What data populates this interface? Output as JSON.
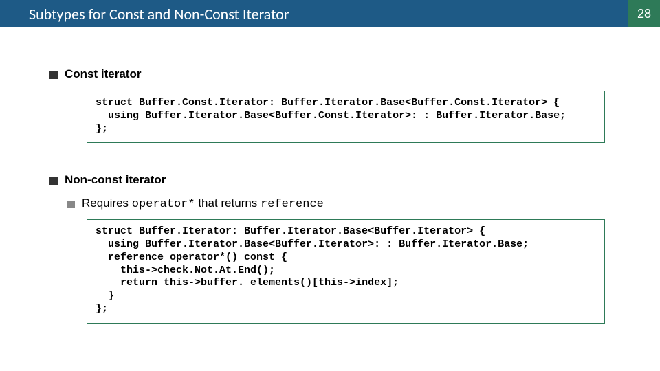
{
  "slide": {
    "number": "28",
    "title": "Subtypes for Const and Non-Const Iterator"
  },
  "sections": [
    {
      "heading": "Const iterator",
      "sub": null,
      "code": "struct Buffer.Const.Iterator: Buffer.Iterator.Base<Buffer.Const.Iterator> {\n  using Buffer.Iterator.Base<Buffer.Const.Iterator>: : Buffer.Iterator.Base;\n};"
    },
    {
      "heading": "Non-const iterator",
      "sub": {
        "prefix": "Requires ",
        "code1": "operator*",
        "mid": " that returns ",
        "code2": "reference"
      },
      "code": "struct Buffer.Iterator: Buffer.Iterator.Base<Buffer.Iterator> {\n  using Buffer.Iterator.Base<Buffer.Iterator>: : Buffer.Iterator.Base;\n  reference operator*() const {\n    this->check.Not.At.End();\n    return this->buffer. elements()[this->index];\n  }\n};"
    }
  ]
}
